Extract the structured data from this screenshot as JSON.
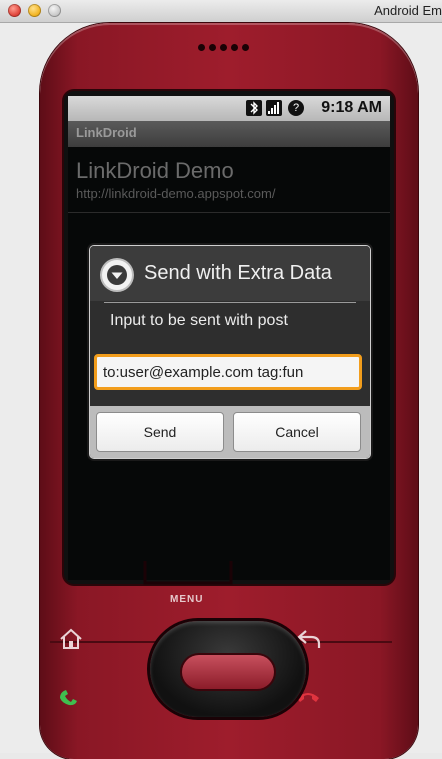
{
  "window": {
    "title": "Android Em"
  },
  "status_bar": {
    "time": "9:18 AM",
    "icons": [
      "bluetooth-icon",
      "signal-icon",
      "help-icon"
    ]
  },
  "app": {
    "title": "LinkDroid"
  },
  "list_item": {
    "title": "LinkDroid Demo",
    "subtitle": "http://linkdroid-demo.appspot.com/"
  },
  "dialog": {
    "title": "Send with Extra Data",
    "icon": "chevron-down-circle-icon",
    "message": "Input to be sent with post",
    "input_value": "to:user@example.com tag:fun",
    "send_label": "Send",
    "cancel_label": "Cancel"
  },
  "device": {
    "menu_label": "MENU",
    "keys": [
      "home-icon",
      "back-icon",
      "call-icon",
      "end-call-icon"
    ],
    "colors": {
      "body": "#9e1d2c",
      "accent_focus": "#f29d1c"
    }
  }
}
